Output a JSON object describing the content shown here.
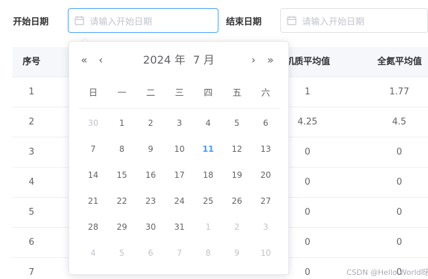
{
  "filters": {
    "start_label": "开始日期",
    "start_placeholder": "请输入开始日期",
    "end_label": "结束日期",
    "end_placeholder": "请输入开始日期"
  },
  "table": {
    "headers": [
      "序号",
      "有机质平均值",
      "全氮平均值"
    ],
    "rows": [
      {
        "index": "1",
        "organic": "1",
        "nitrogen": "1.77"
      },
      {
        "index": "2",
        "organic": "4.25",
        "nitrogen": "4.5"
      },
      {
        "index": "3",
        "organic": "0",
        "nitrogen": "0"
      },
      {
        "index": "4",
        "organic": "0",
        "nitrogen": "0"
      },
      {
        "index": "5",
        "organic": "0",
        "nitrogen": "0"
      },
      {
        "index": "6",
        "organic": "0",
        "nitrogen": "0"
      },
      {
        "index": "7",
        "organic": "0",
        "nitrogen": "0"
      }
    ]
  },
  "picker": {
    "prev_year": "«",
    "prev_month": "‹",
    "next_month": "›",
    "next_year": "»",
    "year_label": "2024 年",
    "month_label": "7 月",
    "weekdays": [
      "日",
      "一",
      "二",
      "三",
      "四",
      "五",
      "六"
    ],
    "weeks": [
      [
        {
          "d": "30",
          "m": 1
        },
        {
          "d": "1"
        },
        {
          "d": "2"
        },
        {
          "d": "3"
        },
        {
          "d": "4"
        },
        {
          "d": "5"
        },
        {
          "d": "6"
        }
      ],
      [
        {
          "d": "7"
        },
        {
          "d": "8"
        },
        {
          "d": "9"
        },
        {
          "d": "10"
        },
        {
          "d": "11",
          "t": 1
        },
        {
          "d": "12"
        },
        {
          "d": "13"
        }
      ],
      [
        {
          "d": "14"
        },
        {
          "d": "15"
        },
        {
          "d": "16"
        },
        {
          "d": "17"
        },
        {
          "d": "18"
        },
        {
          "d": "19"
        },
        {
          "d": "20"
        }
      ],
      [
        {
          "d": "21"
        },
        {
          "d": "22"
        },
        {
          "d": "23"
        },
        {
          "d": "24"
        },
        {
          "d": "25"
        },
        {
          "d": "26"
        },
        {
          "d": "27"
        }
      ],
      [
        {
          "d": "28"
        },
        {
          "d": "29"
        },
        {
          "d": "30"
        },
        {
          "d": "31"
        },
        {
          "d": "1",
          "m": 1
        },
        {
          "d": "2",
          "m": 1
        },
        {
          "d": "3",
          "m": 1
        }
      ],
      [
        {
          "d": "4",
          "m": 1
        },
        {
          "d": "5",
          "m": 1
        },
        {
          "d": "6",
          "m": 1
        },
        {
          "d": "7",
          "m": 1
        },
        {
          "d": "8",
          "m": 1
        },
        {
          "d": "9",
          "m": 1
        },
        {
          "d": "10",
          "m": 1
        }
      ]
    ]
  },
  "watermark": "CSDN @Hello World呀",
  "colors": {
    "accent": "#409eff",
    "border": "#dcdfe6",
    "header_bg": "#f5f7fa"
  }
}
